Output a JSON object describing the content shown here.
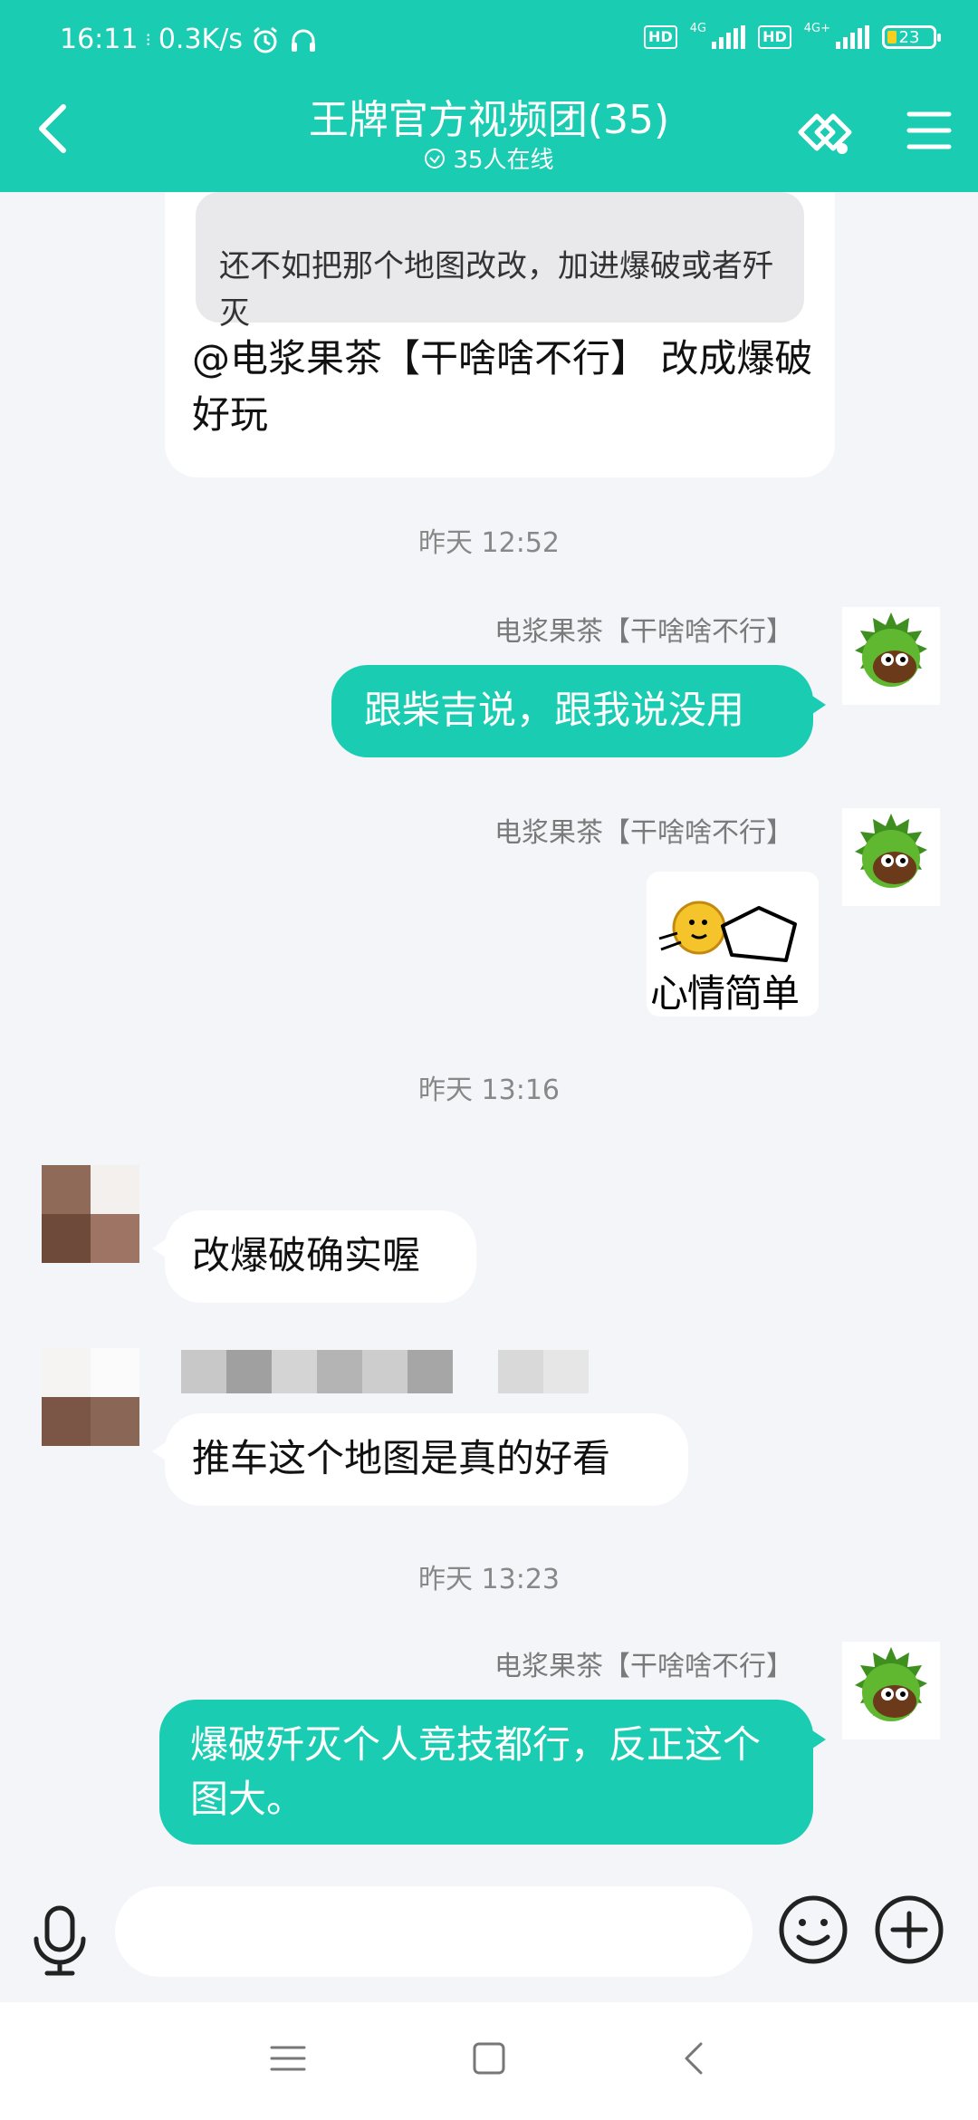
{
  "status_bar": {
    "time": "16:11",
    "speed": "0.3K/s",
    "hd1": "HD",
    "net1": "4G",
    "hd2": "HD",
    "net2": "4G+",
    "battery": "23"
  },
  "header": {
    "title": "王牌官方视频团(35)",
    "online": "35人在线",
    "icons": [
      "back-arrow-icon",
      "link-icon",
      "menu-icon"
    ]
  },
  "messages": {
    "m1": {
      "quote": "还不如把那个地图改改，加进爆破或者歼灭",
      "text": "@电浆果茶【干啥啥不行】 改成爆破好玩"
    },
    "ts1": "昨天 12:52",
    "m2": {
      "sender": "电浆果茶【干啥啥不行】",
      "text": "跟柴吉说，跟我说没用"
    },
    "m3": {
      "sender": "电浆果茶【干啥啥不行】",
      "sticker_caption": "心情简单"
    },
    "ts2": "昨天 13:16",
    "m4": {
      "text": "改爆破确实喔"
    },
    "m5": {
      "text": "推车这个地图是真的好看"
    },
    "ts3": "昨天 13:23",
    "m6": {
      "sender": "电浆果茶【干啥啥不行】",
      "text": "爆破歼灭个人竞技都行，反正这个图大。"
    }
  },
  "input_bar": {
    "value": "",
    "placeholder": ""
  },
  "colors": {
    "accent": "#19ccb2",
    "background": "#f4f5f9",
    "bubble_in": "#ffffff",
    "battery_level": "#f5d020"
  }
}
